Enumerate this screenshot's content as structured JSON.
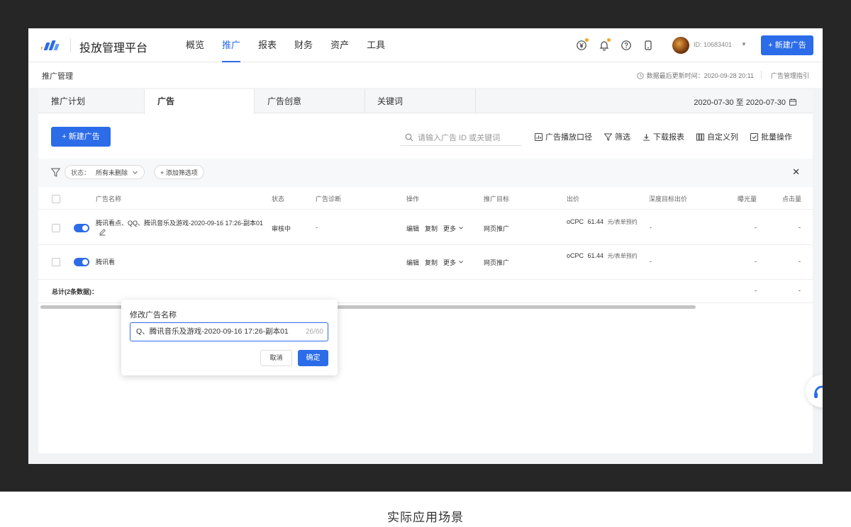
{
  "header": {
    "brand": "投放管理平台",
    "nav": [
      "概览",
      "推广",
      "报表",
      "财务",
      "资产",
      "工具"
    ],
    "active_nav": "推广",
    "icons": [
      "yuan-icon",
      "bell-icon",
      "help-icon",
      "mobile-icon"
    ],
    "user_id": "ID: 10683401",
    "new_ad_label": "+ 新建广告"
  },
  "subheader": {
    "title": "推广管理",
    "update_info": "数据最后更新时间：2020-09-28 20:11",
    "guide_link": "广告管理指引"
  },
  "tabs": [
    "推广计划",
    "广告",
    "广告创意",
    "关键词"
  ],
  "active_tab": "广告",
  "date_range": "2020-07-30 至 2020-07-30",
  "toolbar": {
    "new_ad_label": "+ 新建广告",
    "search_placeholder": "请输入广告 ID 或关键词",
    "tools": [
      "广告播放口径",
      "筛选",
      "下载报表",
      "自定义列",
      "批量操作"
    ]
  },
  "filter": {
    "status_label": "状态：",
    "status_value": "所有未删除",
    "add_filter": "+ 添加筛选项"
  },
  "table": {
    "columns": [
      "广告名称",
      "状态",
      "广告诊断",
      "操作",
      "推广目标",
      "出价",
      "深度目标出价",
      "曝光量",
      "点击量"
    ],
    "rows": [
      {
        "name": "腾讯看点、QQ、腾讯音乐及游戏-2020-09-16 17:26-副本01",
        "status": "审核中",
        "diagnosis": "-",
        "actions": [
          "编辑",
          "复制",
          "更多"
        ],
        "goal": "网页推广",
        "bid_type": "oCPC",
        "bid": "61.44",
        "bid_unit": "元/表单预约",
        "deep_bid": "-",
        "impressions": "-",
        "clicks": "-"
      },
      {
        "name": "腾讯看",
        "status": "",
        "diagnosis": "",
        "actions": [
          "编辑",
          "复制",
          "更多"
        ],
        "goal": "网页推广",
        "bid_type": "oCPC",
        "bid": "61.44",
        "bid_unit": "元/表单预约",
        "deep_bid": "-",
        "impressions": "-",
        "clicks": "-"
      }
    ],
    "total_label": "总计(2条数据)：",
    "total_impressions": "-",
    "total_clicks": "-"
  },
  "popover": {
    "title": "修改广告名称",
    "input_value": "Q、腾讯音乐及游戏-2020-09-16 17:26-副本01",
    "count": "26/60",
    "cancel": "取消",
    "confirm": "确定"
  },
  "caption": "实际应用场景",
  "colors": {
    "primary": "#2c6ce8",
    "notify": "#f5a623"
  }
}
